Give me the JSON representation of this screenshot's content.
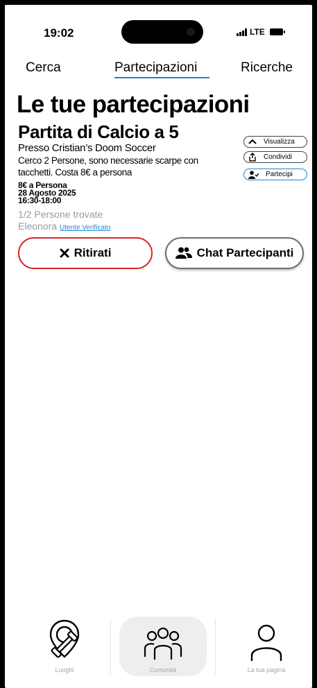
{
  "status_bar": {
    "time": "19:02",
    "network": "LTE"
  },
  "tabs": [
    {
      "label": "Cerca"
    },
    {
      "label": "Partecipazioni"
    },
    {
      "label": "Ricerche"
    }
  ],
  "page_title": "Le tue partecipazioni",
  "event": {
    "title": "Partita di Calcio a 5",
    "venue": "Presso Cristian’s Doom Soccer",
    "description": "Cerco 2 Persone, sono necessarie scarpe con tacchetti. Costa 8€ a persona",
    "price": "8€ a Persona",
    "date": "28 Agosto 2025",
    "time": "16:30-18:00",
    "found": "1/2 Persone trovate",
    "author": "Eleonora",
    "verified": "Utente Verificato"
  },
  "actions": {
    "view": "Visualizza",
    "share": "Condividi",
    "participate": "Partecipi",
    "withdraw": "Ritirati",
    "chat": "Chat Partecipanti"
  },
  "bottom_nav": [
    {
      "label": "Luoghi",
      "icon": "dumbbell-pin-icon"
    },
    {
      "label": "Comunità",
      "icon": "community-icon"
    },
    {
      "label": "La tua pagina",
      "icon": "person-icon"
    }
  ],
  "colors": {
    "accent": "#1f82d6",
    "danger": "#e02424"
  }
}
